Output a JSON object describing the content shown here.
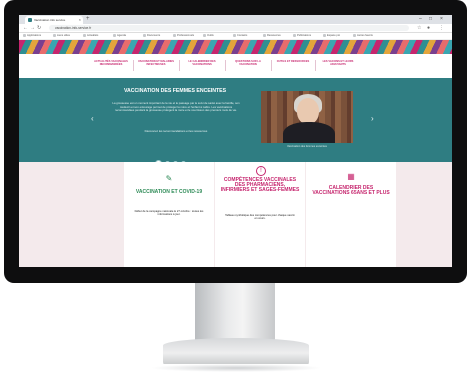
{
  "browser": {
    "tab_title": "Vaccination info service",
    "url": "vaccination-info-service.fr",
    "bookmarks": [
      "Applications",
      "Liens utiles",
      "Actualités",
      "Agenda",
      "Documents",
      "Professionnels",
      "Outils",
      "Contacts",
      "Ressources",
      "Publications",
      "Espace pro",
      "Autres favoris"
    ]
  },
  "nav": {
    "items": [
      "ACTUALITÉS VACCINALES RECOMMANDÉES",
      "VACCINATION ET MALADIES INFECTIEUSES",
      "LE CALENDRIER DES VACCINATIONS",
      "QUESTIONS SUR LA VACCINATION",
      "OUTILS ET RESSOURCES",
      "LES VACCINS ET LEURS ADJUVANTS"
    ]
  },
  "hero": {
    "title": "VACCINATION DES FEMMES ENCEINTES",
    "body": "La grossesse est un moment important de la vie et le passage par le suivi de santé avec la famille, son médecin et son entourage permet de protéger la mère et l'enfant à naître. Les vaccinations recommandées pendant la grossesse protègent la mère et le nourrisson des premiers mois de vie.",
    "link": "Découvrez les recommandations et les ressources",
    "video_caption": "Vaccination des femmes enceintes",
    "dots": 4,
    "active_dot": 0
  },
  "cards": [
    {
      "title": "VACCINATION ET COVID-19",
      "desc": "Début de la campagne nationale le 27 octobre : toutes les informations à jour.",
      "color": "#2e8b57",
      "icon": "syringe-icon"
    },
    {
      "title": "COMPÉTENCES VACCINALES DES PHARMACIENS, INFIRMIERS ET SAGES-FEMMES",
      "desc": "Tableau synthétique des compétences pour chaque vaccin en cours.",
      "color": "#c6266e",
      "icon": "info-icon"
    },
    {
      "title": "CALENDRIER DES VACCINATIONS 65ANS ET PLUS",
      "desc": "",
      "color": "#c6266e",
      "icon": "calendar-icon"
    }
  ]
}
